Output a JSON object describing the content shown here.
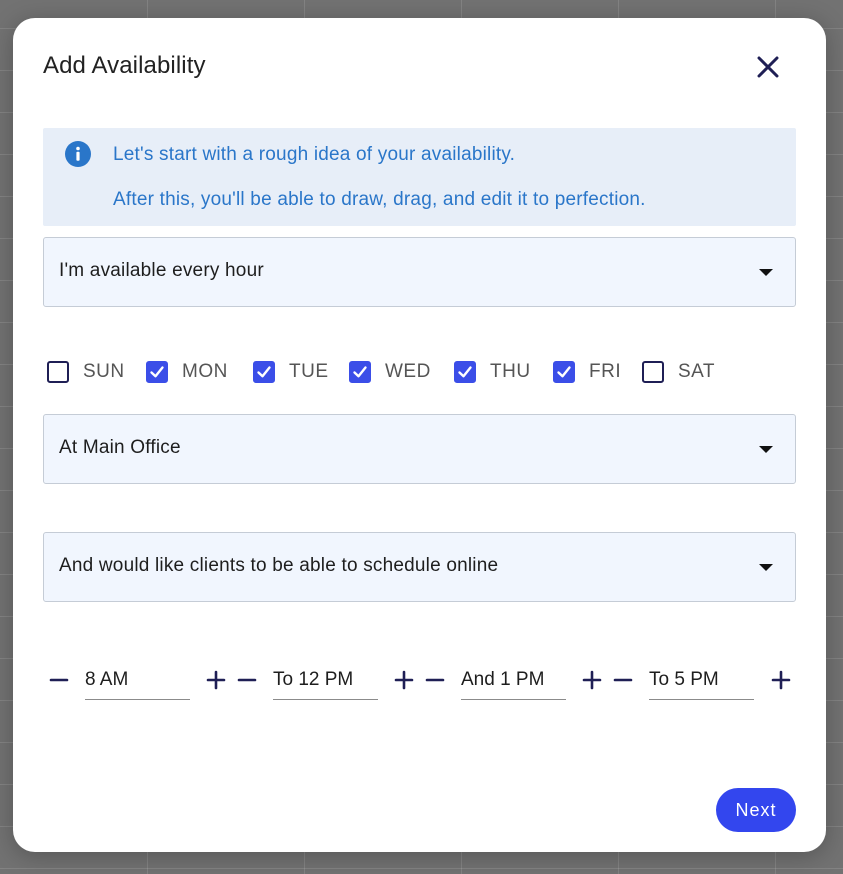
{
  "dialog": {
    "title": "Add Availability",
    "close_icon": "close-icon"
  },
  "info": {
    "icon": "info-icon",
    "line1": "Let's start with a rough idea of your availability.",
    "line2": "After this, you'll be able to draw, drag, and edit it to perfection."
  },
  "hours_select": {
    "value": "I'm available every hour"
  },
  "days": [
    {
      "label": "SUN",
      "checked": false
    },
    {
      "label": "MON",
      "checked": true
    },
    {
      "label": "TUE",
      "checked": true
    },
    {
      "label": "WED",
      "checked": true
    },
    {
      "label": "THU",
      "checked": true
    },
    {
      "label": "FRI",
      "checked": true
    },
    {
      "label": "SAT",
      "checked": false
    }
  ],
  "location_select": {
    "value": "At Main Office"
  },
  "booking_select": {
    "value": "And would like clients to be able to schedule online"
  },
  "times": [
    {
      "value": "8 AM"
    },
    {
      "value": "To 12 PM"
    },
    {
      "value": "And 1 PM"
    },
    {
      "value": "To 5 PM"
    }
  ],
  "footer": {
    "next_label": "Next"
  },
  "colors": {
    "accent": "#3346ee",
    "info_text": "#2a76c9",
    "info_bg": "#e7eef8",
    "select_bg": "#f1f6fe",
    "icon_dark": "#1f1f55"
  }
}
